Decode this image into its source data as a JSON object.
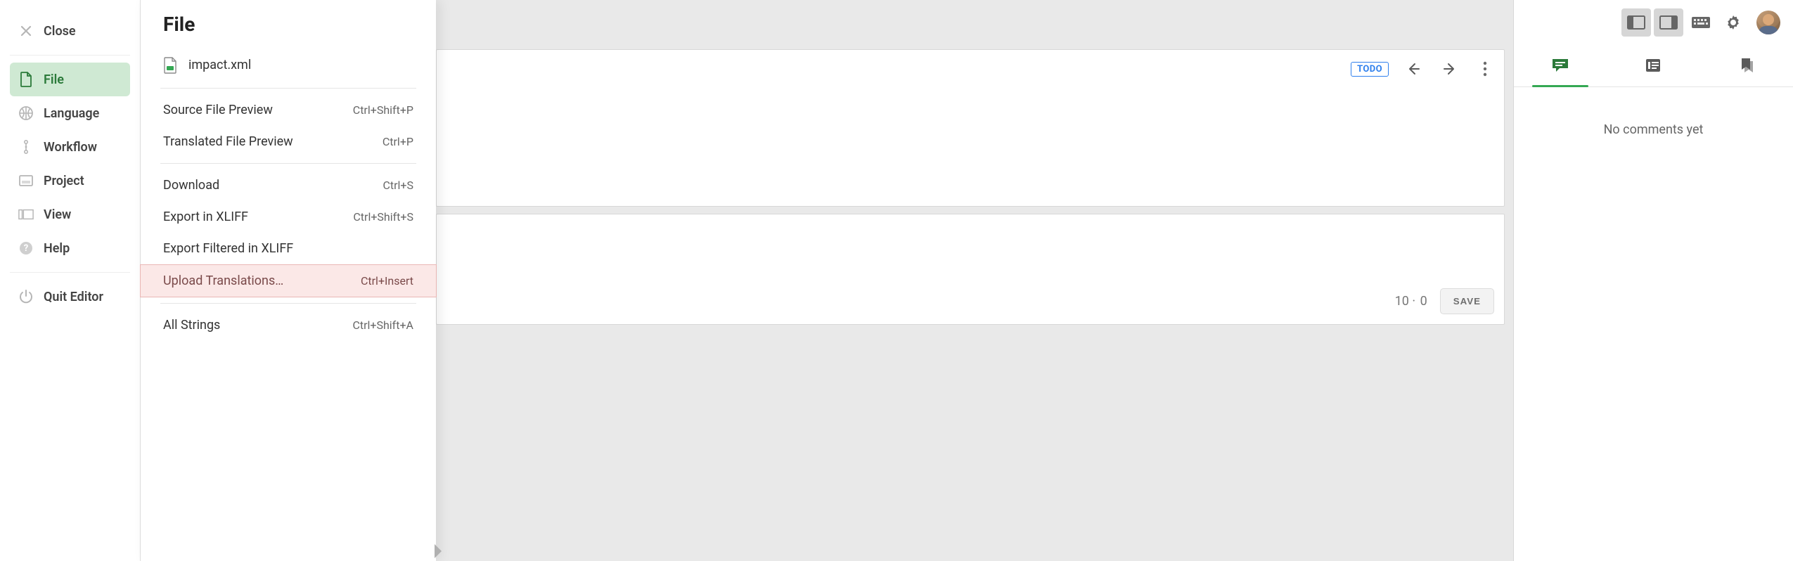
{
  "sidebar": {
    "close_label": "Close",
    "items": [
      {
        "label": "File"
      },
      {
        "label": "Language"
      },
      {
        "label": "Workflow"
      },
      {
        "label": "Project"
      },
      {
        "label": "View"
      },
      {
        "label": "Help"
      }
    ],
    "quit_label": "Quit Editor"
  },
  "menu": {
    "title": "File",
    "filename": "impact.xml",
    "groups": [
      [
        {
          "label": "Source File Preview",
          "shortcut": "Ctrl+Shift+P"
        },
        {
          "label": "Translated File Preview",
          "shortcut": "Ctrl+P"
        }
      ],
      [
        {
          "label": "Download",
          "shortcut": "Ctrl+S"
        },
        {
          "label": "Export in XLIFF",
          "shortcut": "Ctrl+Shift+S"
        },
        {
          "label": "Export Filtered in XLIFF",
          "shortcut": ""
        },
        {
          "label": "Upload Translations…",
          "shortcut": "Ctrl+Insert",
          "highlight": true
        }
      ],
      [
        {
          "label": "All Strings",
          "shortcut": "Ctrl+Shift+A"
        }
      ]
    ]
  },
  "editor": {
    "status_chip": "TODO",
    "counter_left": "10",
    "counter_right": "0",
    "save_label": "SAVE"
  },
  "right_panel": {
    "empty_text": "No comments yet"
  }
}
